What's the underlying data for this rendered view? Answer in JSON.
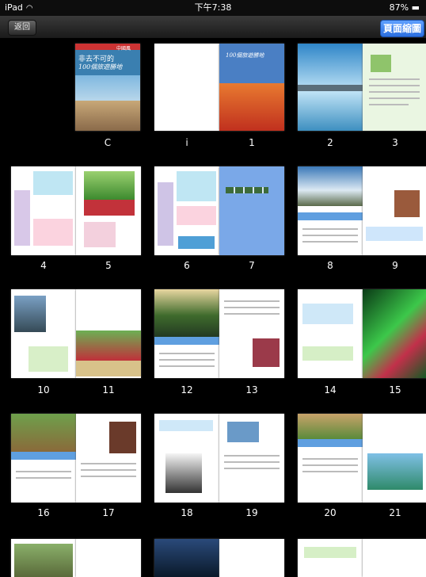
{
  "status": {
    "device": "iPad",
    "time": "下午7:38",
    "battery": "87%"
  },
  "nav": {
    "back_label": "返回",
    "thumb_label": "頁面縮圖"
  },
  "labels": [
    "C",
    "i",
    "1",
    "2",
    "3",
    "4",
    "5",
    "6",
    "7",
    "8",
    "9",
    "10",
    "11",
    "12",
    "13",
    "14",
    "15",
    "16",
    "17",
    "18",
    "19",
    "20",
    "21"
  ],
  "cover": {
    "title": "非去不可的",
    "subtitle": "100個旅遊勝地",
    "title2": "100個旅遊勝地",
    "tag": "中國風"
  }
}
